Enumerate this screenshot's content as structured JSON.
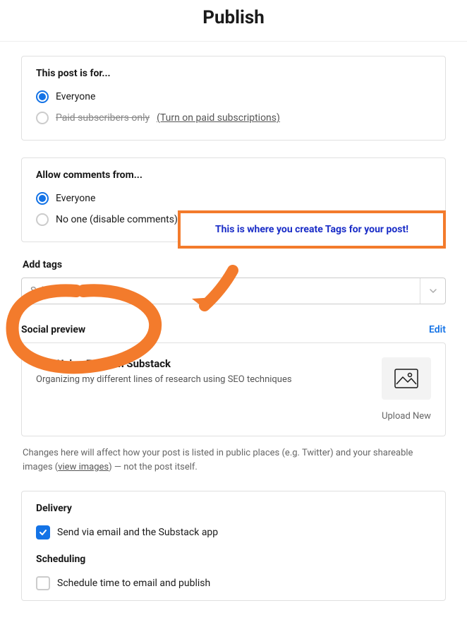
{
  "title": "Publish",
  "audience": {
    "heading": "This post is for...",
    "options": {
      "everyone": "Everyone",
      "paid": "Paid subscribers only",
      "paid_link": "(Turn on paid subscriptions)"
    }
  },
  "comments": {
    "heading": "Allow comments from...",
    "options": {
      "everyone": "Everyone",
      "noone": "No one (disable comments)"
    }
  },
  "callout_text": "This is where you create Tags for your post!",
  "tags": {
    "heading": "Add tags",
    "placeholder": "Select..."
  },
  "social": {
    "heading": "Social preview",
    "edit": "Edit",
    "preview_title": "Tip: Using Tags on Substack",
    "preview_subtitle": "Organizing my different lines of research using SEO techniques",
    "upload": "Upload New",
    "help_prefix": "Changes here will affect how your post is listed in public places (e.g. Twitter) and your shareable images (",
    "help_link": "view images",
    "help_suffix": ") — not the post itself."
  },
  "delivery": {
    "heading": "Delivery",
    "send_label": "Send via email and the Substack app"
  },
  "scheduling": {
    "heading": "Scheduling",
    "schedule_label": "Schedule time to email and publish"
  }
}
